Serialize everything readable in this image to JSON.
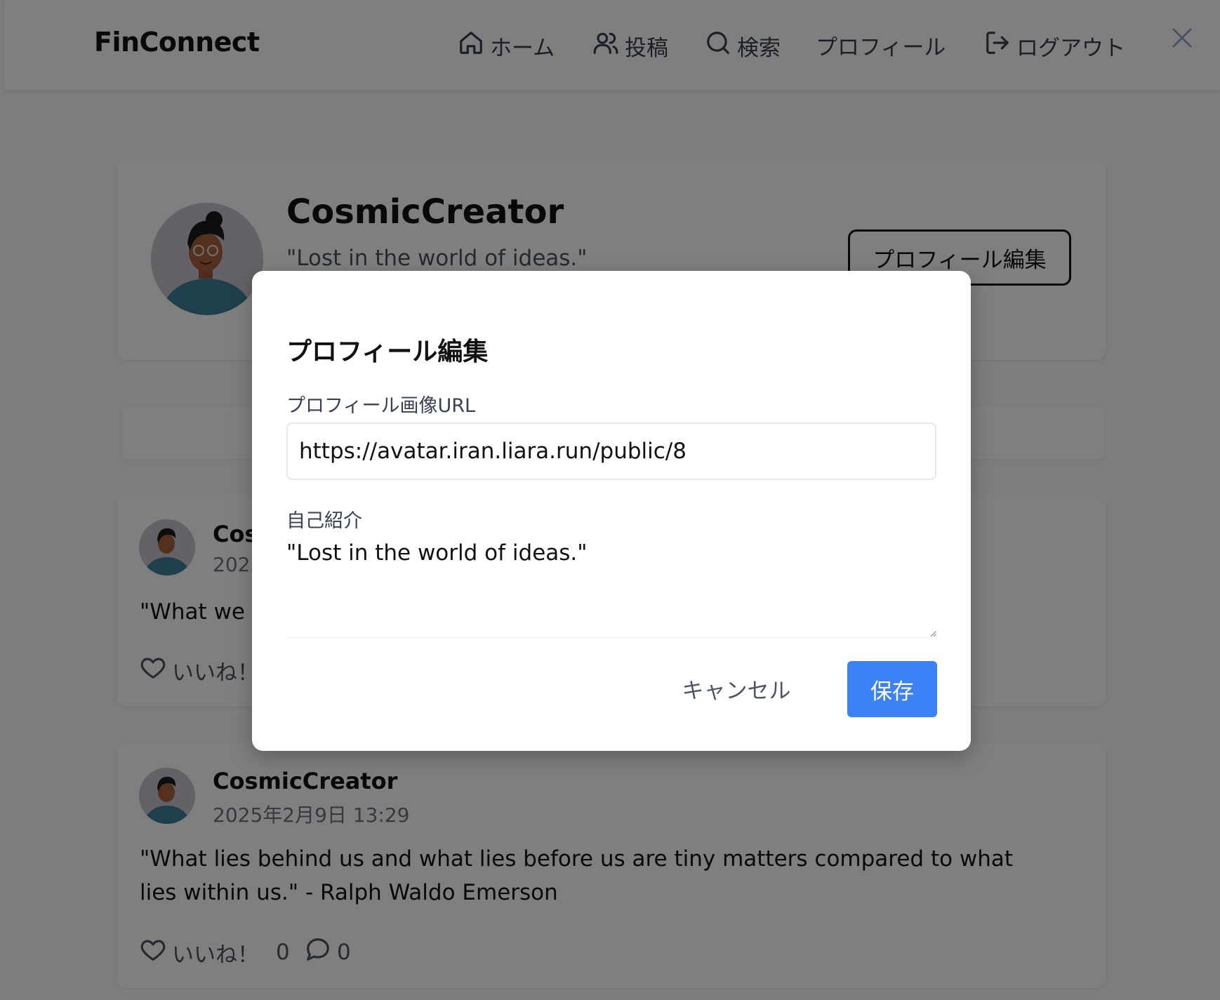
{
  "navbar": {
    "brand": "FinConnect",
    "items": [
      {
        "label": "ホーム",
        "icon": "home-icon"
      },
      {
        "label": "投稿",
        "icon": "users-icon"
      },
      {
        "label": "検索",
        "icon": "search-icon"
      },
      {
        "label": "プロフィール",
        "icon": ""
      },
      {
        "label": "ログアウト",
        "icon": "logout-icon"
      }
    ],
    "close_icon": "close-icon"
  },
  "profile": {
    "name": "CosmicCreator",
    "bio": "\"Lost in the world of ideas.\"",
    "edit_button": "プロフィール編集"
  },
  "posts": [
    {
      "author": "Cos",
      "date": "2025",
      "text": "\"What we a",
      "like_label": "いいね！"
    },
    {
      "author": "CosmicCreator",
      "date": "2025年2月9日 13:29",
      "text": "\"What lies behind us and what lies before us are tiny matters compared to what lies within us.\" - Ralph Waldo Emerson",
      "like_label": "いいね！",
      "likes": "0",
      "comments": "0"
    }
  ],
  "modal": {
    "title": "プロフィール編集",
    "url_label": "プロフィール画像URL",
    "url_value": "https://avatar.iran.liara.run/public/8",
    "bio_label": "自己紹介",
    "bio_value": "\"Lost in the world of ideas.\"",
    "cancel_label": "キャンセル",
    "save_label": "保存"
  },
  "colors": {
    "accent": "#3b82f6",
    "overlay": "rgba(0,0,0,0.5)",
    "avatar_bg": "#c8c2cf",
    "avatar_shirt": "#3d7f97"
  }
}
